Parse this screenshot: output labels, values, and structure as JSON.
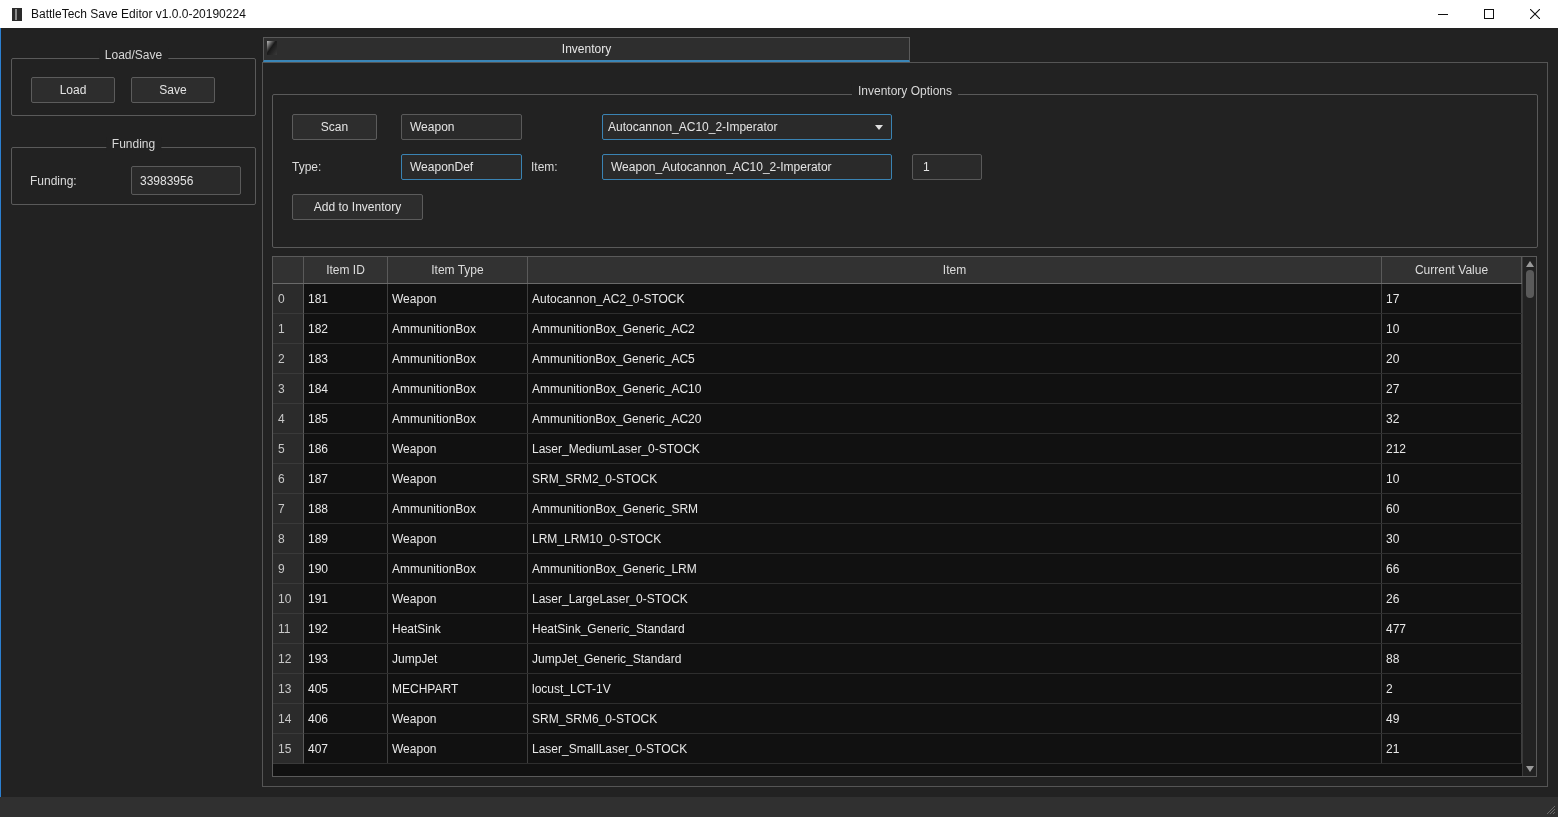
{
  "window": {
    "title": "BattleTech Save Editor v1.0.0-20190224"
  },
  "left_panel": {
    "load_save": {
      "title": "Load/Save",
      "buttons": [
        "Load",
        "Save"
      ]
    },
    "funding": {
      "title": "Funding",
      "label": "Funding:",
      "value": "33983956"
    }
  },
  "tabs": [
    {
      "label": "Inventory",
      "selected": true
    }
  ],
  "inventory_options": {
    "title": "Inventory Options",
    "scan_button": "Scan",
    "search_field": {
      "value": "Weapon",
      "highlighted": false
    },
    "item_dropdown": {
      "value": "Autocannon_AC10_2-Imperator",
      "highlighted": true
    },
    "type_label": "Type:",
    "type_field": {
      "value": "WeaponDef",
      "highlighted": true
    },
    "item_label": "Item:",
    "item_field": {
      "value": "Weapon_Autocannon_AC10_2-Imperator",
      "highlighted": true
    },
    "quantity_field": {
      "value": "1",
      "highlighted": false
    },
    "add_button": "Add to Inventory"
  },
  "table": {
    "columns": [
      "Item ID",
      "Item Type",
      "Item",
      "Current Value"
    ],
    "rows": [
      {
        "number": "0",
        "cells": [
          "181",
          "Weapon",
          "Autocannon_AC2_0-STOCK",
          "17"
        ]
      },
      {
        "number": "1",
        "cells": [
          "182",
          "AmmunitionBox",
          "AmmunitionBox_Generic_AC2",
          "10"
        ]
      },
      {
        "number": "2",
        "cells": [
          "183",
          "AmmunitionBox",
          "AmmunitionBox_Generic_AC5",
          "20"
        ]
      },
      {
        "number": "3",
        "cells": [
          "184",
          "AmmunitionBox",
          "AmmunitionBox_Generic_AC10",
          "27"
        ]
      },
      {
        "number": "4",
        "cells": [
          "185",
          "AmmunitionBox",
          "AmmunitionBox_Generic_AC20",
          "32"
        ]
      },
      {
        "number": "5",
        "cells": [
          "186",
          "Weapon",
          "Laser_MediumLaser_0-STOCK",
          "212"
        ]
      },
      {
        "number": "6",
        "cells": [
          "187",
          "Weapon",
          "SRM_SRM2_0-STOCK",
          "10"
        ]
      },
      {
        "number": "7",
        "cells": [
          "188",
          "AmmunitionBox",
          "AmmunitionBox_Generic_SRM",
          "60"
        ]
      },
      {
        "number": "8",
        "cells": [
          "189",
          "Weapon",
          "LRM_LRM10_0-STOCK",
          "30"
        ]
      },
      {
        "number": "9",
        "cells": [
          "190",
          "AmmunitionBox",
          "AmmunitionBox_Generic_LRM",
          "66"
        ]
      },
      {
        "number": "10",
        "cells": [
          "191",
          "Weapon",
          "Laser_LargeLaser_0-STOCK",
          "26"
        ]
      },
      {
        "number": "11",
        "cells": [
          "192",
          "HeatSink",
          "HeatSink_Generic_Standard",
          "477"
        ]
      },
      {
        "number": "12",
        "cells": [
          "193",
          "JumpJet",
          "JumpJet_Generic_Standard",
          "88"
        ]
      },
      {
        "number": "13",
        "cells": [
          "405",
          "MECHPART",
          "locust_LCT-1V",
          "2"
        ]
      },
      {
        "number": "14",
        "cells": [
          "406",
          "Weapon",
          "SRM_SRM6_0-STOCK",
          "49"
        ]
      },
      {
        "number": "15",
        "cells": [
          "407",
          "Weapon",
          "Laser_SmallLaser_0-STOCK",
          "21"
        ]
      }
    ]
  }
}
